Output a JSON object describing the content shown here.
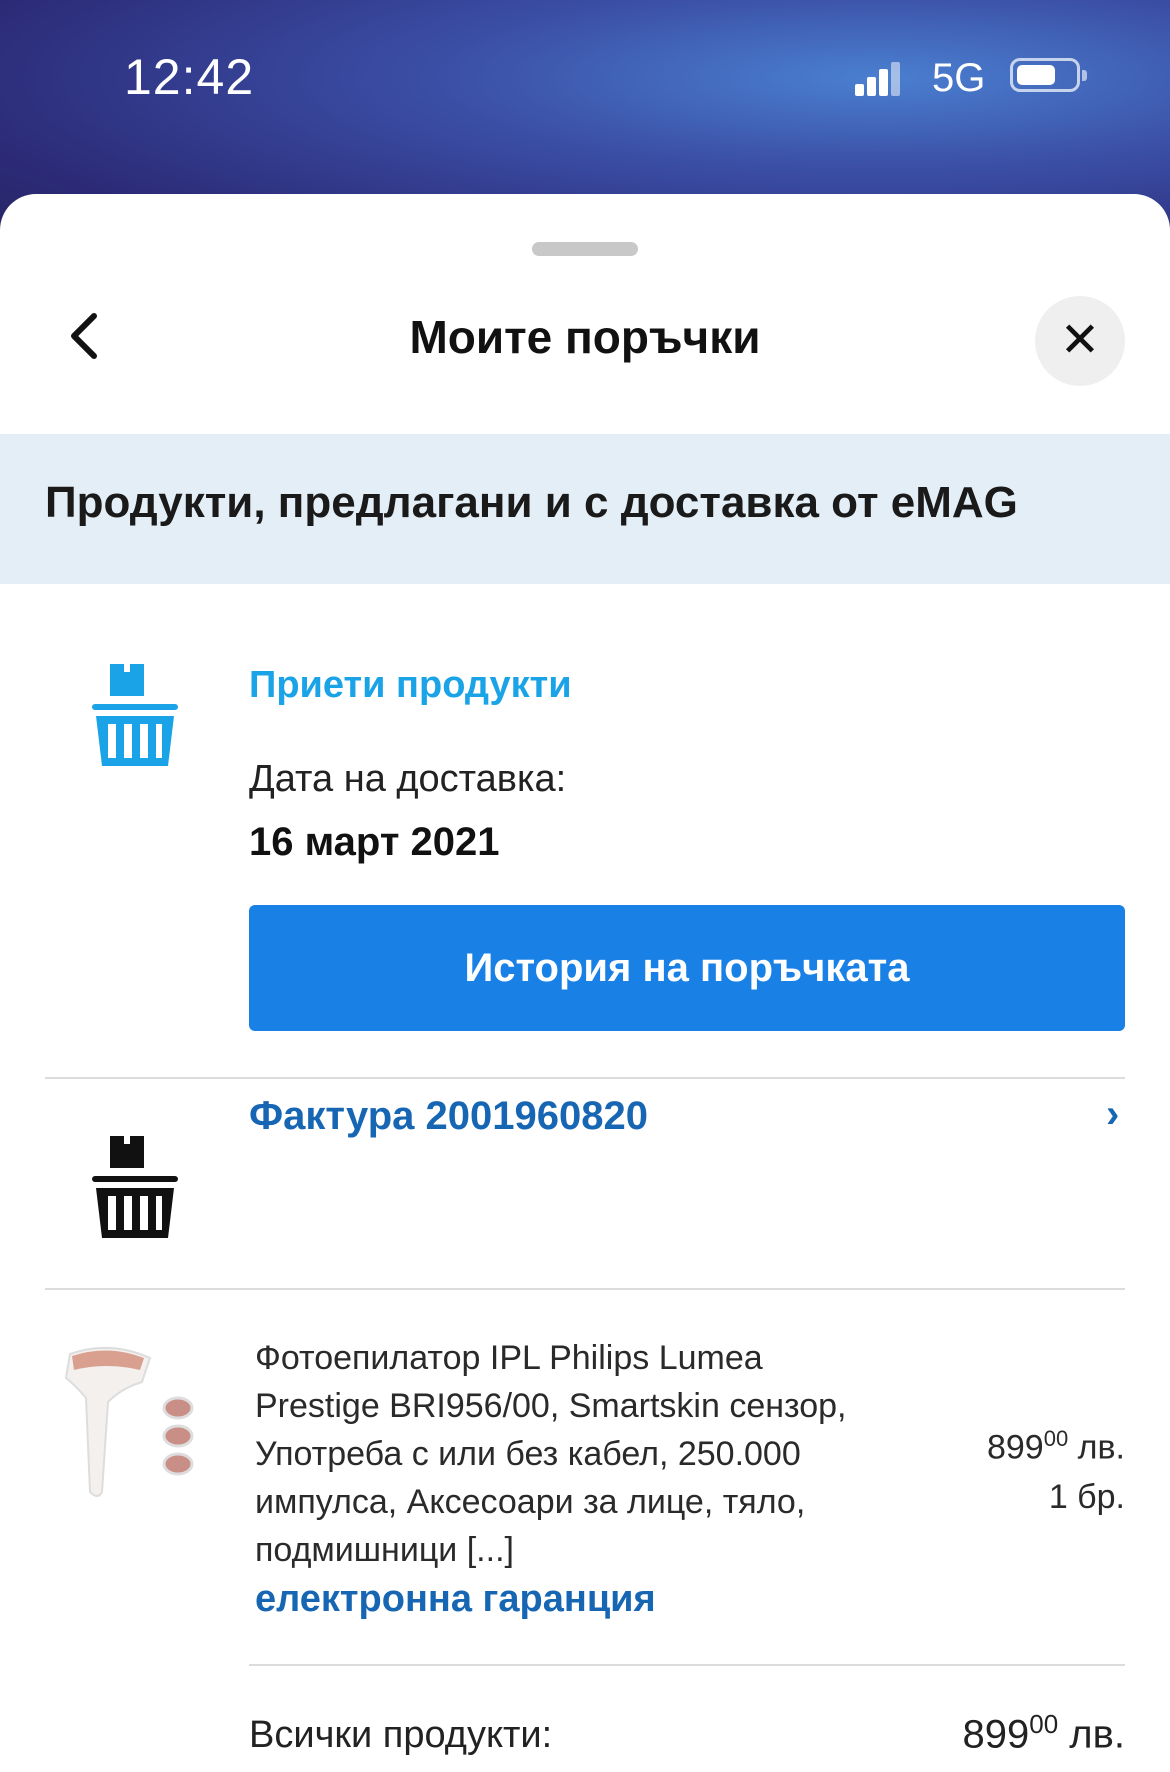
{
  "status_bar": {
    "time": "12:42",
    "network": "5G"
  },
  "header": {
    "title": "Моите поръчки"
  },
  "banner": {
    "text": "Продукти, предлагани и с доставка от eMAG"
  },
  "order": {
    "status_label": "Приети продукти",
    "delivery_date_label": "Дата на доставка:",
    "delivery_date": "16 март 2021",
    "history_button_label": "История на поръчката",
    "invoice_label": "Фактура 2001960820",
    "invoice_chevron": "›"
  },
  "product": {
    "name": "Фотоепилатор IPL Philips Lumea Prestige BRI956/00, Smartskin сензор, Употреба с или без кабел, 250.000 импулса, Аксесоари за лице, тяло, подмишници [...]",
    "warranty_link": "електронна гаранция",
    "price_main": "899",
    "price_cents": "00",
    "currency": "лв.",
    "quantity": "1 бр."
  },
  "summary": {
    "all_products_label": "Всички продукти:",
    "total_main": "899",
    "total_cents": "00",
    "currency": "лв."
  },
  "icons": {
    "back": "chevron-left-icon",
    "close": "close-icon",
    "status_basket": "basket-icon",
    "invoice_basket": "basket-icon"
  },
  "colors": {
    "accent_blue": "#1980e6",
    "status_blue": "#1aa3e6",
    "link_blue": "#1766b3",
    "banner_bg": "#e3eef6"
  }
}
